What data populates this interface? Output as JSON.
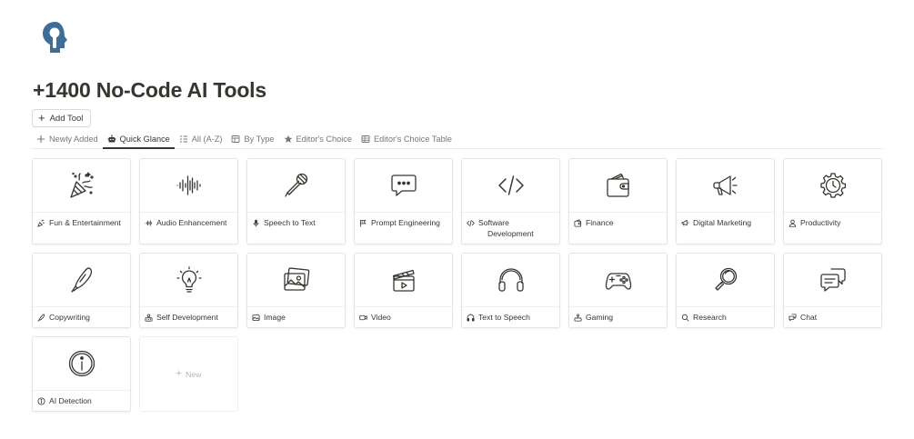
{
  "page": {
    "title": "+1400 No-Code AI Tools",
    "add_button_label": "Add Tool"
  },
  "tabs": [
    {
      "label": "Newly Added",
      "icon": "plus-icon",
      "active": false
    },
    {
      "label": "Quick Glance",
      "icon": "robot-icon",
      "active": true
    },
    {
      "label": "All (A-Z)",
      "icon": "sort-list-icon",
      "active": false
    },
    {
      "label": "By Type",
      "icon": "board-icon",
      "active": false
    },
    {
      "label": "Editor's Choice",
      "icon": "star-icon",
      "active": false
    },
    {
      "label": "Editor's Choice Table",
      "icon": "table-icon",
      "active": false
    }
  ],
  "cards": [
    {
      "label": "Fun & Entertainment",
      "icon": "party-popper-icon"
    },
    {
      "label": "Audio Enhancement",
      "icon": "sound-wave-icon"
    },
    {
      "label": "Speech to Text",
      "icon": "microphone-icon"
    },
    {
      "label": "Prompt Engineering",
      "icon": "speech-bubble-icon"
    },
    {
      "label": "Software Development",
      "icon": "code-brackets-icon",
      "line1": "Software",
      "line2": "Development"
    },
    {
      "label": "Finance",
      "icon": "wallet-icon"
    },
    {
      "label": "Digital Marketing",
      "icon": "megaphone-icon"
    },
    {
      "label": "Productivity",
      "icon": "gear-clock-icon"
    },
    {
      "label": "Copywriting",
      "icon": "quill-pen-icon"
    },
    {
      "label": "Self Development",
      "icon": "lightbulb-icon"
    },
    {
      "label": "Image",
      "icon": "image-icon"
    },
    {
      "label": "Video",
      "icon": "clapperboard-icon"
    },
    {
      "label": "Text to Speech",
      "icon": "headphones-icon"
    },
    {
      "label": "Gaming",
      "icon": "gamepad-icon"
    },
    {
      "label": "Research",
      "icon": "magnifier-icon"
    },
    {
      "label": "Chat",
      "icon": "chat-bubbles-icon"
    },
    {
      "label": "AI Detection",
      "icon": "info-circle-icon"
    }
  ],
  "new_card_label": "New",
  "colors": {
    "text": "#37352f",
    "muted": "#787774",
    "logo_blue": "#3e6e95"
  }
}
